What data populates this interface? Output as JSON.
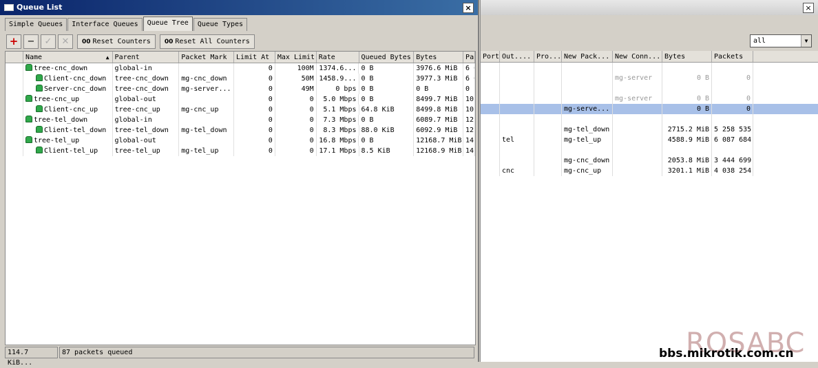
{
  "window": {
    "title": "Queue List",
    "close": "×"
  },
  "tabs": [
    "Simple Queues",
    "Interface Queues",
    "Queue Tree",
    "Queue Types"
  ],
  "toolbar": {
    "add": "+",
    "remove": "−",
    "enable": "✓",
    "disable": "✕",
    "reset_counters": "Reset Counters",
    "reset_all_counters": "Reset All Counters",
    "reset_prefix": "00"
  },
  "columns": [
    "Name",
    "Parent",
    "Packet Mark",
    "Limit At",
    "Max Limit",
    "Rate",
    "Queued Bytes",
    "Bytes",
    "Pa"
  ],
  "rows": [
    {
      "name": "tree-cnc_down",
      "parent": "global-in",
      "mark": "",
      "limit_at": "0",
      "max_limit": "100M",
      "rate": "1374.6...",
      "queued": "0 B",
      "bytes": "3976.6 MiB",
      "pa": "6 6",
      "child": false
    },
    {
      "name": "Client-cnc_down",
      "parent": "tree-cnc_down",
      "mark": "mg-cnc_down",
      "limit_at": "0",
      "max_limit": "50M",
      "rate": "1458.9...",
      "queued": "0 B",
      "bytes": "3977.3 MiB",
      "pa": "6 6",
      "child": true
    },
    {
      "name": "Server-cnc_down",
      "parent": "tree-cnc_down",
      "mark": "mg-server...",
      "limit_at": "0",
      "max_limit": "49M",
      "rate": "0 bps",
      "queued": "0 B",
      "bytes": "0 B",
      "pa": "0",
      "child": true
    },
    {
      "name": "tree-cnc_up",
      "parent": "global-out",
      "mark": "",
      "limit_at": "0",
      "max_limit": "0",
      "rate": "5.0 Mbps",
      "queued": "0 B",
      "bytes": "8499.7 MiB",
      "pa": "10",
      "child": false
    },
    {
      "name": "Client-cnc_up",
      "parent": "tree-cnc_up",
      "mark": "mg-cnc_up",
      "limit_at": "0",
      "max_limit": "0",
      "rate": "5.1 Mbps",
      "queued": "64.8 KiB",
      "bytes": "8499.8 MiB",
      "pa": "10",
      "child": true
    },
    {
      "name": "tree-tel_down",
      "parent": "global-in",
      "mark": "",
      "limit_at": "0",
      "max_limit": "0",
      "rate": "7.3 Mbps",
      "queued": "0 B",
      "bytes": "6089.7 MiB",
      "pa": "12",
      "child": false
    },
    {
      "name": "Client-tel_down",
      "parent": "tree-tel_down",
      "mark": "mg-tel_down",
      "limit_at": "0",
      "max_limit": "0",
      "rate": "8.3 Mbps",
      "queued": "88.0 KiB",
      "bytes": "6092.9 MiB",
      "pa": "12",
      "child": true
    },
    {
      "name": "tree-tel_up",
      "parent": "global-out",
      "mark": "",
      "limit_at": "0",
      "max_limit": "0",
      "rate": "16.8 Mbps",
      "queued": "0 B",
      "bytes": "12168.7 MiB",
      "pa": "14",
      "child": false
    },
    {
      "name": "Client-tel_up",
      "parent": "tree-tel_up",
      "mark": "mg-tel_up",
      "limit_at": "0",
      "max_limit": "0",
      "rate": "17.1 Mbps",
      "queued": "8.5 KiB",
      "bytes": "12168.9 MiB",
      "pa": "14",
      "child": true
    }
  ],
  "status": {
    "queued_bytes": "114.7 KiB...",
    "packets": "87 packets queued"
  },
  "right_window": {
    "close": "×",
    "filter": "all",
    "filter_arrow": "▼",
    "columns": [
      "Port",
      "Out....",
      "Pro...",
      "New Pack...",
      "New Conn...",
      "Bytes",
      "Packets"
    ],
    "rows": [
      {
        "port": "",
        "out": "",
        "pro": "",
        "new_pack": "",
        "new_conn": "",
        "bytes": "",
        "packets": "",
        "style": ""
      },
      {
        "port": "",
        "out": "",
        "pro": "",
        "new_pack": "",
        "new_conn": "mg-server",
        "bytes": "0 B",
        "packets": "0",
        "style": "dis"
      },
      {
        "port": "",
        "out": "",
        "pro": "",
        "new_pack": "",
        "new_conn": "",
        "bytes": "",
        "packets": "",
        "style": ""
      },
      {
        "port": "",
        "out": "",
        "pro": "",
        "new_pack": "",
        "new_conn": "mg-server",
        "bytes": "0 B",
        "packets": "0",
        "style": "dis"
      },
      {
        "port": "",
        "out": "",
        "pro": "",
        "new_pack": "mg-serve...",
        "new_conn": "",
        "bytes": "0 B",
        "packets": "0",
        "style": "sel"
      },
      {
        "port": "",
        "out": "",
        "pro": "",
        "new_pack": "",
        "new_conn": "",
        "bytes": "",
        "packets": "",
        "style": ""
      },
      {
        "port": "",
        "out": "",
        "pro": "",
        "new_pack": "mg-tel_down",
        "new_conn": "",
        "bytes": "2715.2 MiB",
        "packets": "5 258 535",
        "style": ""
      },
      {
        "port": "",
        "out": "tel",
        "pro": "",
        "new_pack": "mg-tel_up",
        "new_conn": "",
        "bytes": "4588.9 MiB",
        "packets": "6 087 684",
        "style": ""
      },
      {
        "port": "",
        "out": "",
        "pro": "",
        "new_pack": "",
        "new_conn": "",
        "bytes": "",
        "packets": "",
        "style": ""
      },
      {
        "port": "",
        "out": "",
        "pro": "",
        "new_pack": "mg-cnc_down",
        "new_conn": "",
        "bytes": "2053.8 MiB",
        "packets": "3 444 699",
        "style": ""
      },
      {
        "port": "",
        "out": "cnc",
        "pro": "",
        "new_pack": "mg-cnc_up",
        "new_conn": "",
        "bytes": "3201.1 MiB",
        "packets": "4 038 254",
        "style": ""
      }
    ]
  },
  "watermark": {
    "brand": "ROSABC",
    "site": "bbs.mikrotik.com.cn"
  }
}
